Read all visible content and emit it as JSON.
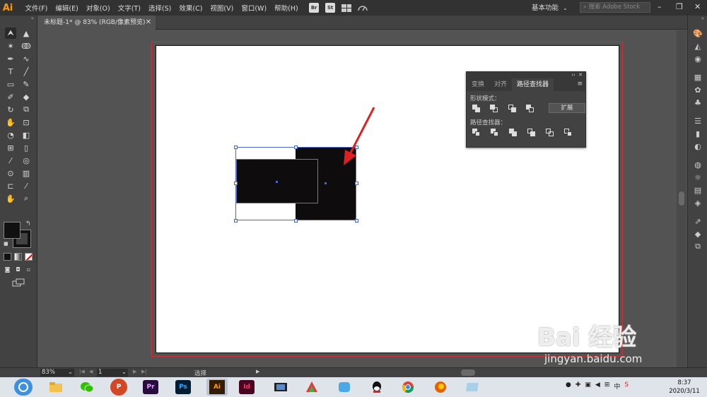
{
  "app": {
    "logo": "Ai"
  },
  "menu": [
    "文件(F)",
    "编辑(E)",
    "对象(O)",
    "文字(T)",
    "选择(S)",
    "效果(C)",
    "视图(V)",
    "窗口(W)",
    "帮助(H)"
  ],
  "menubar_icons": {
    "bridge": "Br",
    "stock": "St"
  },
  "workspace": {
    "label": "基本功能"
  },
  "search": {
    "placeholder": "搜索 Adobe Stock"
  },
  "window_controls": {
    "minimize": "–",
    "restore": "❐",
    "close": "✕"
  },
  "document_tab": {
    "title": "未标题-1* @ 83% (RGB/像素预览)",
    "close": "✕"
  },
  "pathfinder_panel": {
    "tabs": [
      "变换",
      "对齐",
      "路径查找器"
    ],
    "active_tab": 2,
    "shape_modes_label": "形状模式：",
    "expand_label": "扩展",
    "pathfinders_label": "路径查找器："
  },
  "statusbar": {
    "zoom": "83%",
    "page": "1",
    "status": "选择"
  },
  "taskbar": {
    "apps": [
      "Pr",
      "Ps",
      "Ai",
      "Id"
    ],
    "clock_time": "8:37",
    "clock_date": "2020/3/11"
  },
  "watermark": {
    "brand": "Bai 经验",
    "url": "jingyan.baidu.com"
  },
  "colors": {
    "accent": "#ff9a00",
    "selection": "#4a66c8",
    "artwork": "#0e0c0c",
    "arrow": "#e02020"
  }
}
